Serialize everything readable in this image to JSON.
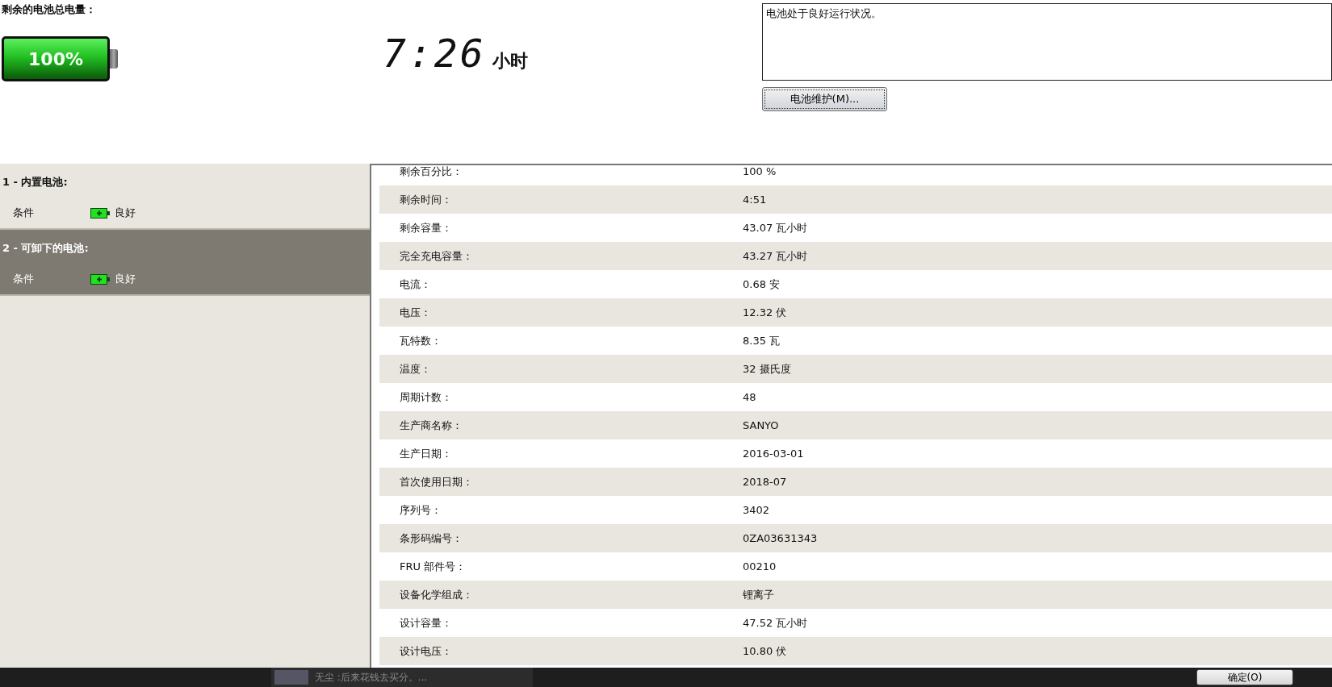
{
  "summary": {
    "label": "剩余的电池总电量：",
    "battery": {
      "level": 1.0,
      "text": "100%"
    },
    "time": "7:26",
    "time_unit": "小时",
    "status_message": "电池处于良好运行状况。",
    "maintenance_button": "电池维护(M)..."
  },
  "batteries": [
    {
      "title": "1 - 内置电池:",
      "selected": false,
      "condition_label": "条件",
      "condition": "良好"
    },
    {
      "title": "2 - 可卸下的电池:",
      "selected": true,
      "condition_label": "条件",
      "condition": "良好"
    }
  ],
  "details": [
    {
      "label": "剩余百分比：",
      "value": "100 %"
    },
    {
      "label": "剩余时间：",
      "value": "4:51"
    },
    {
      "label": "剩余容量：",
      "value": "43.07 瓦小时"
    },
    {
      "label": "完全充电容量：",
      "value": "43.27 瓦小时"
    },
    {
      "label": "电流：",
      "value": "0.68 安"
    },
    {
      "label": "电压：",
      "value": "12.32 伏"
    },
    {
      "label": "瓦特数：",
      "value": "8.35 瓦"
    },
    {
      "label": "温度：",
      "value": "32 摄氏度"
    },
    {
      "label": "周期计数：",
      "value": "48"
    },
    {
      "label": "生产商名称：",
      "value": "SANYO"
    },
    {
      "label": "生产日期：",
      "value": "2016-03-01"
    },
    {
      "label": "首次使用日期：",
      "value": "2018-07"
    },
    {
      "label": "序列号：",
      "value": "3402"
    },
    {
      "label": "条形码编号：",
      "value": "0ZA03631343"
    },
    {
      "label": "FRU 部件号：",
      "value": "00210"
    },
    {
      "label": "设备化学组成：",
      "value": "锂离子"
    },
    {
      "label": "设计容量：",
      "value": "47.52 瓦小时"
    },
    {
      "label": "设计电压：",
      "value": "10.80 伏"
    }
  ],
  "bottom_bar": {
    "notification": "无尘 :后来花钱去买分。...",
    "ok_button": "确定(O)"
  }
}
